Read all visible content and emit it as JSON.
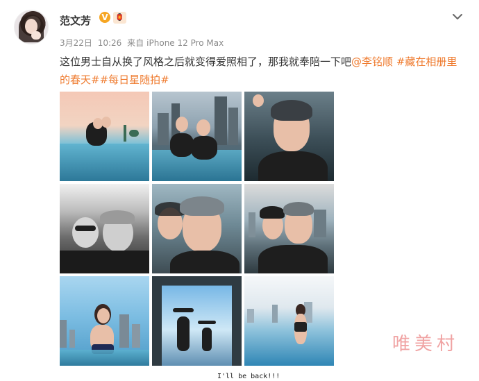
{
  "post": {
    "username": "范文芳",
    "verified_badge": "V",
    "level_badge": "🏮",
    "date": "3月22日",
    "time": "10:26",
    "source_prefix": "来自",
    "source_device": "iPhone 12 Pro Max",
    "text_main": "这位男士自从换了风格之后就变得爱照相了，那我就奉陪一下吧",
    "mention": "@李铭顺",
    "tag1": "#藏在相册里的春天#",
    "tag2": "#每日星随拍#",
    "photo_caption": "I'll be back!!!",
    "watermark": "唯美村"
  },
  "icons": {
    "menu": "chevron-down-icon",
    "verified": "verified-v-icon",
    "level": "level-badge-icon"
  },
  "colors": {
    "link": "#ef7b2f",
    "meta": "#8a8a8a",
    "badge": "#f6a623",
    "watermark": "#f0a3a3"
  }
}
